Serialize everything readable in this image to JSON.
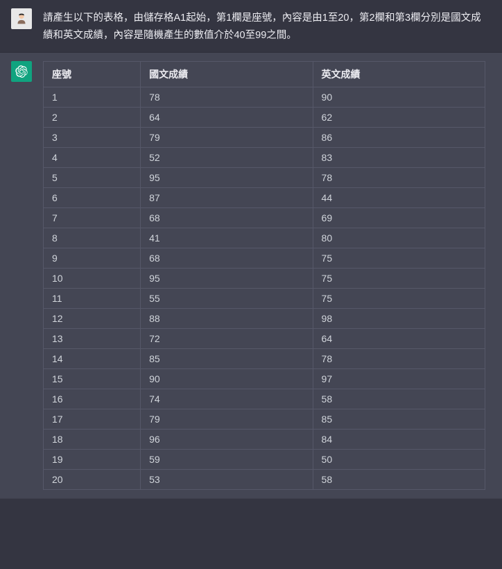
{
  "user_message": "請產生以下的表格，由儲存格A1起始，第1欄是座號，內容是由1至20，第2欄和第3欄分別是國文成績和英文成績，內容是隨機產生的數值介於40至99之間。",
  "table": {
    "headers": [
      "座號",
      "國文成績",
      "英文成績"
    ],
    "rows": [
      [
        "1",
        "78",
        "90"
      ],
      [
        "2",
        "64",
        "62"
      ],
      [
        "3",
        "79",
        "86"
      ],
      [
        "4",
        "52",
        "83"
      ],
      [
        "5",
        "95",
        "78"
      ],
      [
        "6",
        "87",
        "44"
      ],
      [
        "7",
        "68",
        "69"
      ],
      [
        "8",
        "41",
        "80"
      ],
      [
        "9",
        "68",
        "75"
      ],
      [
        "10",
        "95",
        "75"
      ],
      [
        "11",
        "55",
        "75"
      ],
      [
        "12",
        "88",
        "98"
      ],
      [
        "13",
        "72",
        "64"
      ],
      [
        "14",
        "85",
        "78"
      ],
      [
        "15",
        "90",
        "97"
      ],
      [
        "16",
        "74",
        "58"
      ],
      [
        "17",
        "79",
        "85"
      ],
      [
        "18",
        "96",
        "84"
      ],
      [
        "19",
        "59",
        "50"
      ],
      [
        "20",
        "53",
        "58"
      ]
    ]
  }
}
